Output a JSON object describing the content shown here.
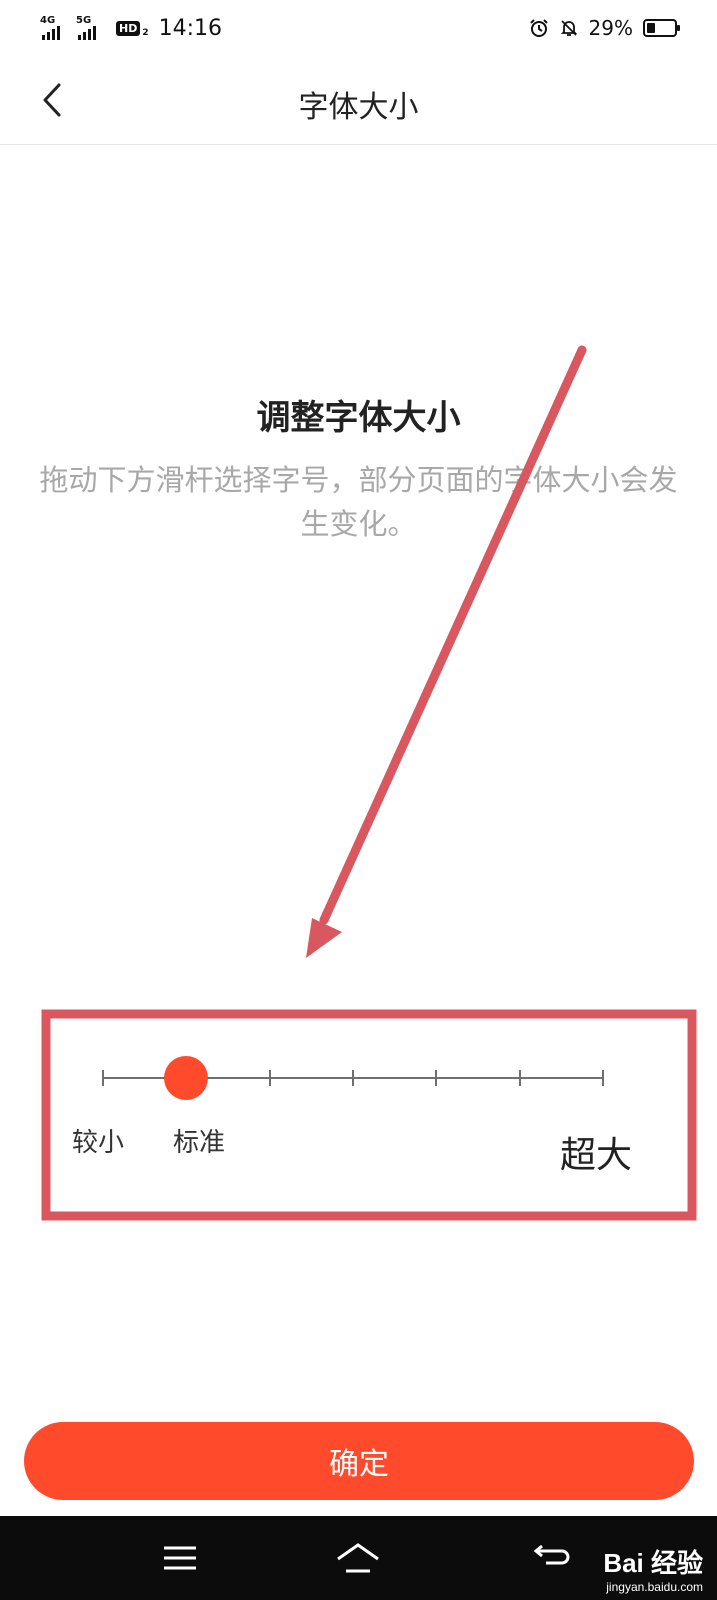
{
  "status_bar": {
    "net1_label": "4G",
    "net2_label": "5G",
    "hd_label": "HD",
    "hd_sub": "2",
    "time": "14:16",
    "battery_percent": "29%",
    "battery_level": 0.29
  },
  "header": {
    "title": "字体大小"
  },
  "intro": {
    "title": "调整字体大小",
    "description": "拖动下方滑杆选择字号，部分页面的字体大小会发生变化。"
  },
  "slider": {
    "positions": 7,
    "selected_index": 1,
    "label_small": "较小",
    "label_standard": "标准",
    "label_xlarge": "超大"
  },
  "confirm_button": {
    "label": "确定"
  },
  "watermark": {
    "brand": "Bai 经验",
    "url": "jingyan.baidu.com"
  },
  "colors": {
    "accent": "#ff4b2b",
    "annotation": "#d9575f",
    "nav_bar": "#0c0c0c",
    "muted_text": "#a8a8a8"
  },
  "icons": {
    "back": "chevron-left-icon",
    "alarm": "alarm-icon",
    "mute": "bell-off-icon",
    "menu": "menu-icon",
    "home": "home-icon",
    "back_nav": "back-arrow-icon"
  }
}
